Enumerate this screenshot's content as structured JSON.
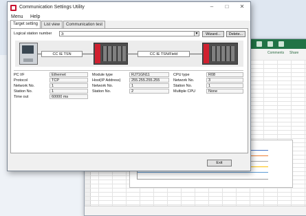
{
  "dialog": {
    "title": "Communication Settings Utility",
    "controls": {
      "minimize": "–",
      "maximize": "□",
      "close": "✕"
    },
    "menu": [
      "Menu",
      "Help"
    ],
    "tabs": [
      "Target setting",
      "List view",
      "Communication test"
    ],
    "station_label": "Logical station number",
    "station_value": "3:",
    "wizard_button": "Wizard...",
    "delete_button": "Delete...",
    "network_left": "CC IE TSN",
    "network_right": "CC IE TSN/Field",
    "pc": {
      "rows": [
        {
          "label": "PC I/F",
          "value": "Ethernet"
        },
        {
          "label": "Protocol",
          "value": "TCP"
        },
        {
          "label": "Network No.",
          "value": "1"
        },
        {
          "label": "Station No.",
          "value": "1"
        },
        {
          "label": "Time out",
          "value": "60000 ms"
        }
      ]
    },
    "module": {
      "rows": [
        {
          "label": "Module type",
          "value": "RJ71GN11"
        },
        {
          "label": "Host(IP Address)",
          "value": "255.255.255.255"
        },
        {
          "label": "Network No.",
          "value": "1"
        },
        {
          "label": "Station No.",
          "value": "2"
        }
      ]
    },
    "cpu": {
      "rows": [
        {
          "label": "CPU type",
          "value": "R08"
        },
        {
          "label": "Network No.",
          "value": "3"
        },
        {
          "label": "Station No.",
          "value": "1"
        },
        {
          "label": "Multiple CPU",
          "value": "None"
        }
      ]
    },
    "exit_button": "Exit"
  },
  "excel": {
    "ribbon": {
      "comments": "Comments",
      "share": "Share"
    },
    "accent": "#217346"
  },
  "colors": {
    "plc_red": "#d0202f",
    "dialog_bg": "#f0f0f0"
  }
}
